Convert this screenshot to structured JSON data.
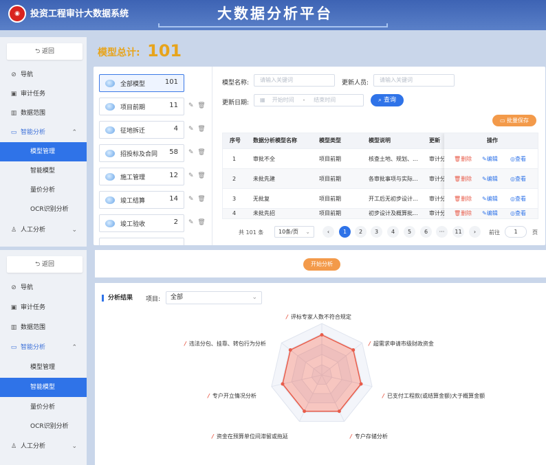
{
  "header": {
    "system_title": "投资工程审计大数据系统",
    "platform_title": "大数据分析平台"
  },
  "sidebar": {
    "back_label": "返回",
    "items": [
      {
        "label": "导航",
        "icon": "compass-icon"
      },
      {
        "label": "审计任务",
        "icon": "calendar-icon"
      },
      {
        "label": "数据范围",
        "icon": "bar-chart-icon"
      },
      {
        "label": "智能分析",
        "icon": "monitor-icon"
      },
      {
        "label": "人工分析",
        "icon": "user-icon"
      }
    ],
    "subitems": [
      "模型管理",
      "智能模型",
      "量价分析",
      "OCR识别分析"
    ]
  },
  "summary": {
    "total_label": "模型总计:",
    "total_value": "101"
  },
  "categories": [
    {
      "name": "全部模型",
      "count": "101"
    },
    {
      "name": "项目前期",
      "count": "11"
    },
    {
      "name": "征地拆迁",
      "count": "4"
    },
    {
      "name": "招投标及合同",
      "count": "58"
    },
    {
      "name": "施工管理",
      "count": "12"
    },
    {
      "name": "竣工结算",
      "count": "14"
    },
    {
      "name": "竣工验收",
      "count": "2"
    }
  ],
  "filters": {
    "model_name_label": "模型名称:",
    "model_name_placeholder": "请输入关键词",
    "updater_label": "更新人员:",
    "updater_placeholder": "请输入关键词",
    "date_label": "更新日期:",
    "start_placeholder": "开始时间",
    "date_sep": "-",
    "end_placeholder": "结束时间",
    "query_label": "查询",
    "batch_save_label": "批量保存"
  },
  "table": {
    "headers": [
      "序号",
      "数据分析模型名称",
      "模型类型",
      "模型说明",
      "更新人",
      "操作"
    ],
    "rows": [
      {
        "no": "1",
        "name": "审批不全",
        "type": "项目前期",
        "desc": "核查土地、规划、...",
        "updater": "审计分"
      },
      {
        "no": "2",
        "name": "未批先建",
        "type": "项目前期",
        "desc": "各审批事项与实际...",
        "updater": "审计分"
      },
      {
        "no": "3",
        "name": "无批复",
        "type": "项目前期",
        "desc": "开工后无初步设计...",
        "updater": "审计分"
      },
      {
        "no": "4",
        "name": "未批先招",
        "type": "项目前期",
        "desc": "初步设计及概算批...",
        "updater": "审计分"
      }
    ],
    "ops": {
      "delete": "删除",
      "edit": "编辑",
      "view": "查看"
    }
  },
  "pager": {
    "total": "共 101 条",
    "size": "10条/页",
    "pages": [
      "1",
      "2",
      "3",
      "4",
      "5",
      "6",
      "···",
      "11"
    ],
    "goto_label": "前往",
    "goto_value": "1",
    "page_unit": "页"
  },
  "analysis": {
    "start_label": "开始分析",
    "title": "分析结果",
    "project_label": "项目:",
    "project_value": "全部",
    "radar_labels": [
      "评标专家人数不符合规定",
      "超需求申请市级财政资金",
      "已支付工程款(或结算金额)大于概算金额",
      "专户存储分析",
      "资金在预算单位间滞留或拖延",
      "专户开立情况分析",
      "违法分包、挂靠、转包行为分析"
    ],
    "radar_values": [
      0.78,
      0.78,
      0.78,
      0.78,
      0.78,
      0.78,
      0.78
    ],
    "colors": {
      "accent": "#2f73e8",
      "orange": "#f39a4a",
      "red": "#e85c4a"
    }
  }
}
